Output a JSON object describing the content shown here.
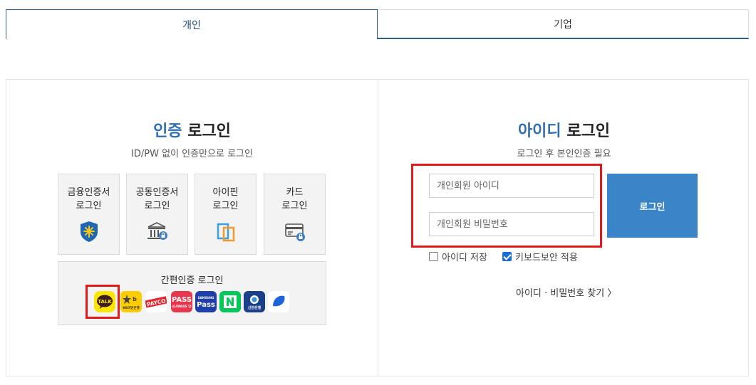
{
  "tabs": [
    {
      "label": "개인",
      "active": true
    },
    {
      "label": "기업",
      "active": false
    }
  ],
  "cert_login": {
    "title_accent": "인증",
    "title_rest": " 로그인",
    "subtitle": "ID/PW 없이 인증만으로 로그인",
    "options": [
      {
        "label": "금융인증서\n로그인",
        "icon": "financial-cert-icon"
      },
      {
        "label": "공동인증서\n로그인",
        "icon": "joint-cert-bank-icon"
      },
      {
        "label": "아이핀\n로그인",
        "icon": "ipin-icon"
      },
      {
        "label": "카드\n로그인",
        "icon": "card-icon"
      }
    ],
    "simple_title": "간편인증 로그인",
    "simple_providers": [
      {
        "name": "kakao",
        "label": "TALK",
        "color": "#fee500"
      },
      {
        "name": "kb",
        "label": "KB",
        "color": "#ffcc00"
      },
      {
        "name": "payco",
        "label": "PAYCO",
        "color": "#e8222a"
      },
      {
        "name": "pass",
        "label": "PASS",
        "color": "#e8364c"
      },
      {
        "name": "samsung-pass",
        "label": "Pass",
        "color": "#1f3fa8"
      },
      {
        "name": "naver",
        "label": "N",
        "color": "#03c75a"
      },
      {
        "name": "shinhan",
        "label": "신한은행",
        "color": "#1c3f8a"
      },
      {
        "name": "toss",
        "label": "",
        "color": "#1b64da"
      }
    ]
  },
  "id_login": {
    "title_accent": "아이디",
    "title_rest": " 로그인",
    "subtitle": "로그인 후 본인인증 필요",
    "id_placeholder": "개인회원 아이디",
    "pw_placeholder": "개인회원 비밀번호",
    "login_button": "로그인",
    "save_id_label": "아이디 저장",
    "save_id_checked": false,
    "keyboard_security_label": "키보드보안 적용",
    "keyboard_security_checked": true,
    "find_link": "아이디 · 비밀번호 찾기 〉"
  },
  "colors": {
    "accent": "#2f6fb0",
    "button": "#3a85c8",
    "highlight": "#e21a1a"
  }
}
